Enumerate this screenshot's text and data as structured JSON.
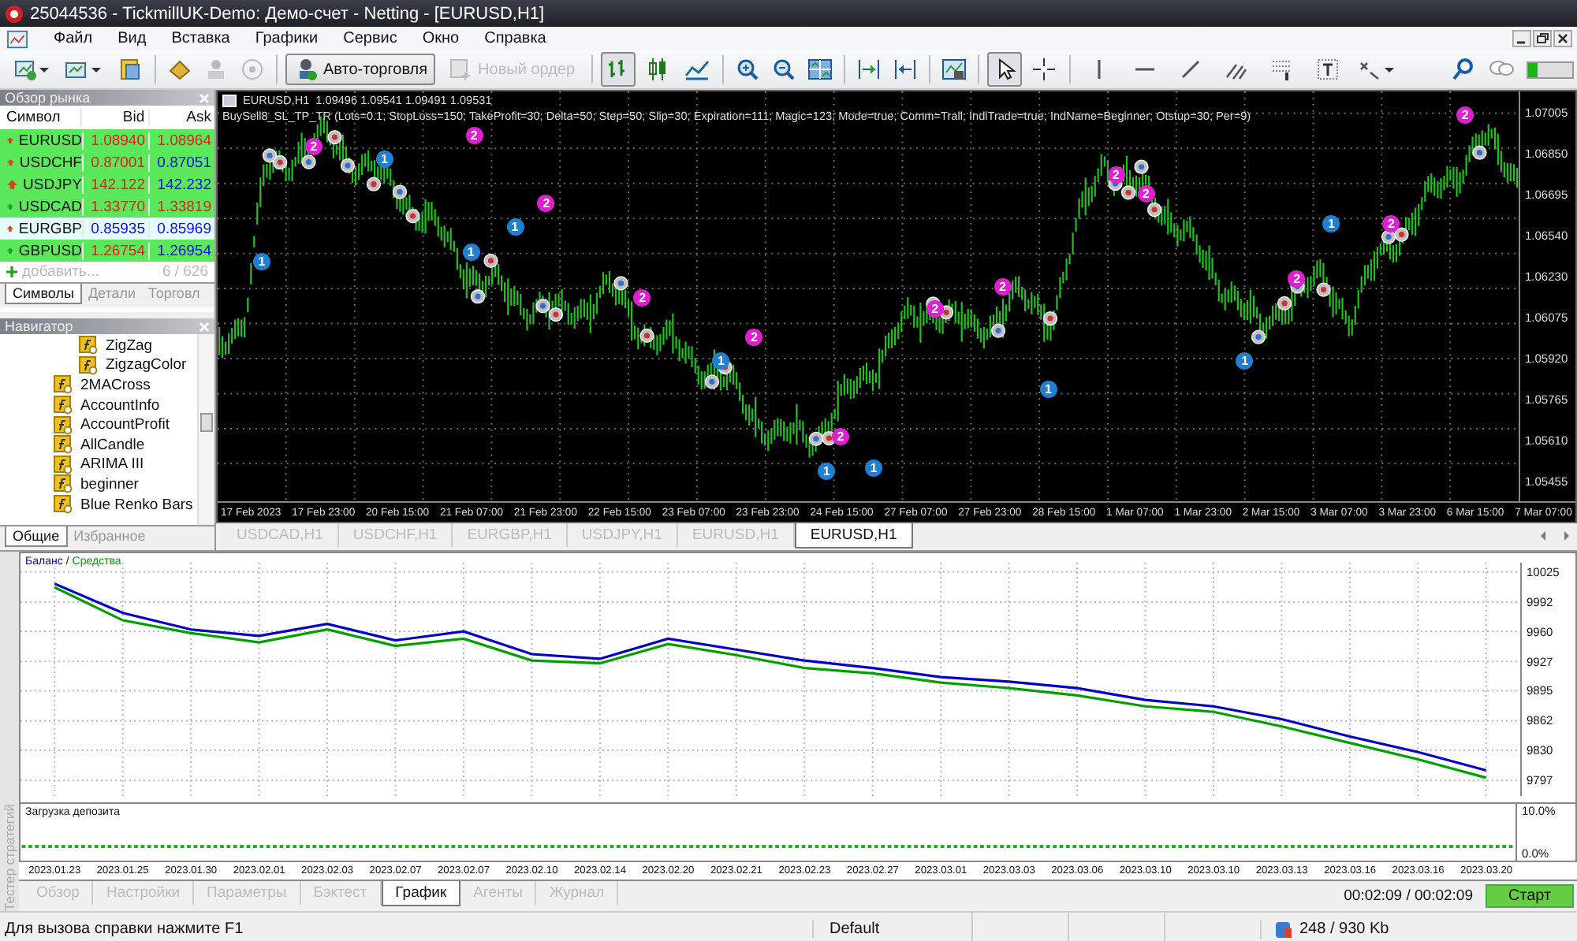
{
  "window": {
    "title": "25044536 - TickmillUK-Demo: Демо-счет - Netting - [EURUSD,H1]"
  },
  "menu": [
    "Файл",
    "Вид",
    "Вставка",
    "Графики",
    "Сервис",
    "Окно",
    "Справка"
  ],
  "toolbar": {
    "autotrading": {
      "label": "Авто-торговля",
      "on": true
    },
    "new_order": {
      "label": "Новый ордер",
      "disabled": true
    },
    "chart_types": [
      {
        "selected": true
      },
      {
        "selected": false
      },
      {
        "selected": false
      }
    ],
    "pointer_tools": [
      {
        "selected": true
      },
      {
        "selected": false
      }
    ]
  },
  "market_watch": {
    "title": "Обзор рынка",
    "columns": [
      "Символ",
      "Bid",
      "Ask"
    ],
    "rows": [
      {
        "symbol": "EURUSD",
        "rising": false,
        "bid": "1.08940",
        "bid_up": false,
        "ask": "1.08964",
        "ask_up": false,
        "selected": false
      },
      {
        "symbol": "USDCHF",
        "rising": false,
        "bid": "0.87001",
        "bid_up": false,
        "ask": "0.87051",
        "ask_up": true,
        "selected": false
      },
      {
        "symbol": "USDJPY",
        "rising": false,
        "bid": "142.122",
        "bid_up": false,
        "ask": "142.232",
        "ask_up": true,
        "selected": false
      },
      {
        "symbol": "USDCAD",
        "rising": true,
        "bid": "1.33770",
        "bid_up": false,
        "ask": "1.33819",
        "ask_up": false,
        "selected": false
      },
      {
        "symbol": "EURGBP",
        "rising": false,
        "bid": "0.85935",
        "bid_up": true,
        "ask": "0.85969",
        "ask_up": true,
        "selected": true
      },
      {
        "symbol": "GBPUSD",
        "rising": true,
        "bid": "1.26754",
        "bid_up": false,
        "ask": "1.26954",
        "ask_up": true,
        "selected": false
      }
    ],
    "add_label": "добавить...",
    "count": "6 / 626",
    "tabs": [
      {
        "label": "Символы",
        "selected": true
      },
      {
        "label": "Детали",
        "selected": false
      },
      {
        "label": "Торговл",
        "selected": false
      }
    ]
  },
  "navigator": {
    "title": "Навигатор",
    "items": [
      {
        "children": [
          {
            "label": "ZigZag"
          },
          {
            "label": "ZigzagColor"
          }
        ]
      },
      {
        "label": "2MACross"
      },
      {
        "label": "AccountInfo"
      },
      {
        "label": "AccountProfit"
      },
      {
        "label": "AllCandle"
      },
      {
        "label": "ARIMA III"
      },
      {
        "label": "beginner"
      },
      {
        "label": "Blue Renko Bars"
      }
    ],
    "tabs": [
      {
        "label": "Общие",
        "selected": true
      },
      {
        "label": "Избранное",
        "selected": false
      }
    ]
  },
  "chart": {
    "symbol": "EURUSD,H1",
    "prices": "1.09496 1.09541 1.09491 1.09531",
    "expert": "BuySell8_SL_TP_TR (Lots=0.1; StopLoss=150; TakeProfit=30; Delta=50; Step=50; Slip=30; Expiration=111; Magic=123; Mode=true; Comm=Trall; IndiTrade=true; IndName=Beginner; Otstup=30; Per=9)",
    "price_labels": [
      "1.07005",
      "1.06850",
      "1.06695",
      "1.06540",
      "1.06230",
      "1.06075",
      "1.05920",
      "1.05765",
      "1.05610",
      "1.05455"
    ],
    "time_labels": [
      "17 Feb 2023",
      "17 Feb 23:00",
      "20 Feb 15:00",
      "21 Feb 07:00",
      "21 Feb 23:00",
      "22 Feb 15:00",
      "23 Feb 07:00",
      "23 Feb 23:00",
      "24 Feb 15:00",
      "27 Feb 07:00",
      "27 Feb 23:00",
      "28 Feb 15:00",
      "1 Mar 07:00",
      "1 Mar 23:00",
      "2 Mar 15:00",
      "3 Mar 07:00",
      "3 Mar 23:00",
      "6 Mar 15:00",
      "7 Mar 07:00"
    ],
    "marks": [
      {
        "label": "1",
        "kind": "buy"
      },
      {
        "label": "1",
        "kind": "buy"
      },
      {
        "label": "1",
        "kind": "buy"
      },
      {
        "label": "1",
        "kind": "buy"
      },
      {
        "label": "1",
        "kind": "buy"
      },
      {
        "label": "1",
        "kind": "buy"
      },
      {
        "label": "1",
        "kind": "buy"
      },
      {
        "label": "1",
        "kind": "buy"
      },
      {
        "label": "1",
        "kind": "buy"
      },
      {
        "label": "1",
        "kind": "buy"
      },
      {
        "label": "2",
        "kind": "sell"
      },
      {
        "label": "2",
        "kind": "sell"
      },
      {
        "label": "2",
        "kind": "sell"
      },
      {
        "label": "2",
        "kind": "sell"
      },
      {
        "label": "2",
        "kind": "sell"
      },
      {
        "label": "2",
        "kind": "sell"
      },
      {
        "label": "2",
        "kind": "sell"
      },
      {
        "label": "2",
        "kind": "sell"
      },
      {
        "label": "2",
        "kind": "sell"
      },
      {
        "label": "2",
        "kind": "sell"
      },
      {
        "label": "2",
        "kind": "sell"
      },
      {
        "label": "2",
        "kind": "sell"
      },
      {
        "label": "2",
        "kind": "sell"
      }
    ],
    "tabs": [
      {
        "label": "USDCAD,H1",
        "selected": false
      },
      {
        "label": "USDCHF,H1",
        "selected": false
      },
      {
        "label": "EURGBP,H1",
        "selected": false
      },
      {
        "label": "USDJPY,H1",
        "selected": false
      },
      {
        "label": "EURUSD,H1",
        "selected": false
      },
      {
        "label": "EURUSD,H1",
        "selected": true
      }
    ]
  },
  "tester": {
    "side_label": "Тестер стратегий",
    "legend_separator": "/",
    "balance_chart": {
      "chart_data": {
        "type": "line",
        "categories": [
          "2023.01.23",
          "2023.01.25",
          "2023.01.30",
          "2023.02.01",
          "2023.02.03",
          "2023.02.07",
          "2023.02.07",
          "2023.02.10",
          "2023.02.14",
          "2023.02.20",
          "2023.02.21",
          "2023.02.23",
          "2023.02.27",
          "2023.03.01",
          "2023.03.03",
          "2023.03.06",
          "2023.03.10",
          "2023.03.10",
          "2023.03.13",
          "2023.03.16",
          "2023.03.16",
          "2023.03.20"
        ],
        "series": [
          {
            "name": "Баланс",
            "color": "#0000c8",
            "values": [
              10012,
              9980,
              9962,
              9955,
              9968,
              9950,
              9960,
              9935,
              9930,
              9952,
              9940,
              9928,
              9920,
              9910,
              9905,
              9898,
              9885,
              9878,
              9864,
              9845,
              9828,
              9808
            ]
          },
          {
            "name": "Средства",
            "color": "#00a000",
            "values": [
              10008,
              9972,
              9958,
              9948,
              9962,
              9944,
              9952,
              9928,
              9925,
              9946,
              9934,
              9920,
              9914,
              9904,
              9898,
              9890,
              9878,
              9872,
              9856,
              9838,
              9820,
              9800
            ]
          }
        ],
        "ylim": [
          9780,
          10035
        ],
        "grid": true,
        "yticks": [
          10025,
          9992,
          9960,
          9927,
          9895,
          9862,
          9830,
          9797
        ]
      }
    },
    "deposit": {
      "title": "Загрузка депозита",
      "labels": [
        "10.0%",
        "0.0%"
      ]
    },
    "tabs": [
      {
        "label": "Обзор",
        "selected": false
      },
      {
        "label": "Настройки",
        "selected": false
      },
      {
        "label": "Параметры",
        "selected": false
      },
      {
        "label": "Бэктест",
        "selected": false
      },
      {
        "label": "График",
        "selected": true
      },
      {
        "label": "Агенты",
        "selected": false
      },
      {
        "label": "Журнал",
        "selected": false
      }
    ],
    "elapsed": "00:02:09 / 00:02:09",
    "start_button": "Старт"
  },
  "status_bar": {
    "help": "Для вызова справки нажмите F1",
    "profile": "Default",
    "traffic": "248 / 930 Kb"
  }
}
